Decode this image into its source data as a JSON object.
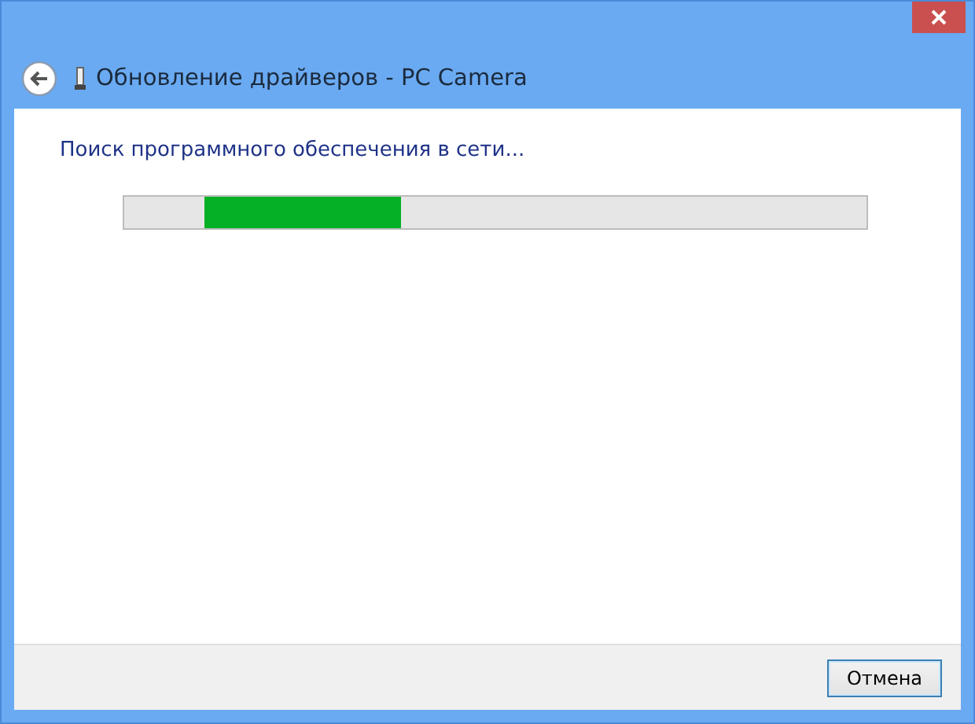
{
  "window": {
    "title": "Обновление драйверов - PC Camera"
  },
  "status": {
    "text": "Поиск программного обеспечения в сети..."
  },
  "progress": {
    "kind": "marquee"
  },
  "buttons": [
    {
      "label": "Отмена"
    }
  ]
}
